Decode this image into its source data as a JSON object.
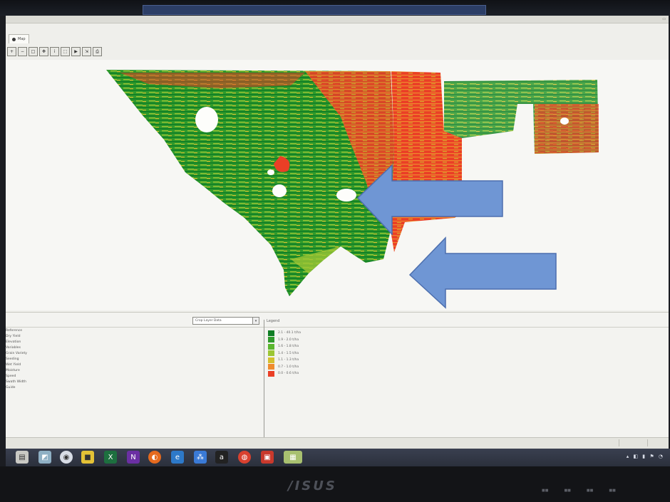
{
  "window": {
    "title": ""
  },
  "tab": {
    "label": "Map"
  },
  "toolbar": {
    "buttons": [
      "zoom-in",
      "zoom-out",
      "zoom-extent",
      "pan",
      "identify",
      "select",
      "play",
      "export",
      "print"
    ]
  },
  "layer_select": {
    "value": "Crop Layer Data"
  },
  "legend": {
    "title": "Legend",
    "entries": [
      {
        "label": "2.1 - 40.1 t/ha",
        "color": "#0e7d24"
      },
      {
        "label": "1.9 - 2.0 t/ha",
        "color": "#2f9a2c"
      },
      {
        "label": "1.6 - 1.8 t/ha",
        "color": "#5ab62e"
      },
      {
        "label": "1.4 - 1.5 t/ha",
        "color": "#9cc634"
      },
      {
        "label": "1.1 - 1.3 t/ha",
        "color": "#d4c02e"
      },
      {
        "label": "0.7 - 1.0 t/ha",
        "color": "#ef8b2d"
      },
      {
        "label": "0.0 - 0.6 t/ha",
        "color": "#ea3f26"
      }
    ]
  },
  "layers": [
    "Reference",
    "Dry Yield",
    "Elevation",
    "Variables",
    "Grain Variety",
    "Seeding",
    "Wet Yield",
    "Moisture",
    "Speed",
    "Swath Width",
    "Guide"
  ],
  "monitor": {
    "brand": "/ISUS"
  },
  "colors": {
    "high": "#1f8a2a",
    "low": "#ea3f26",
    "arrow": "#6f96d4"
  }
}
